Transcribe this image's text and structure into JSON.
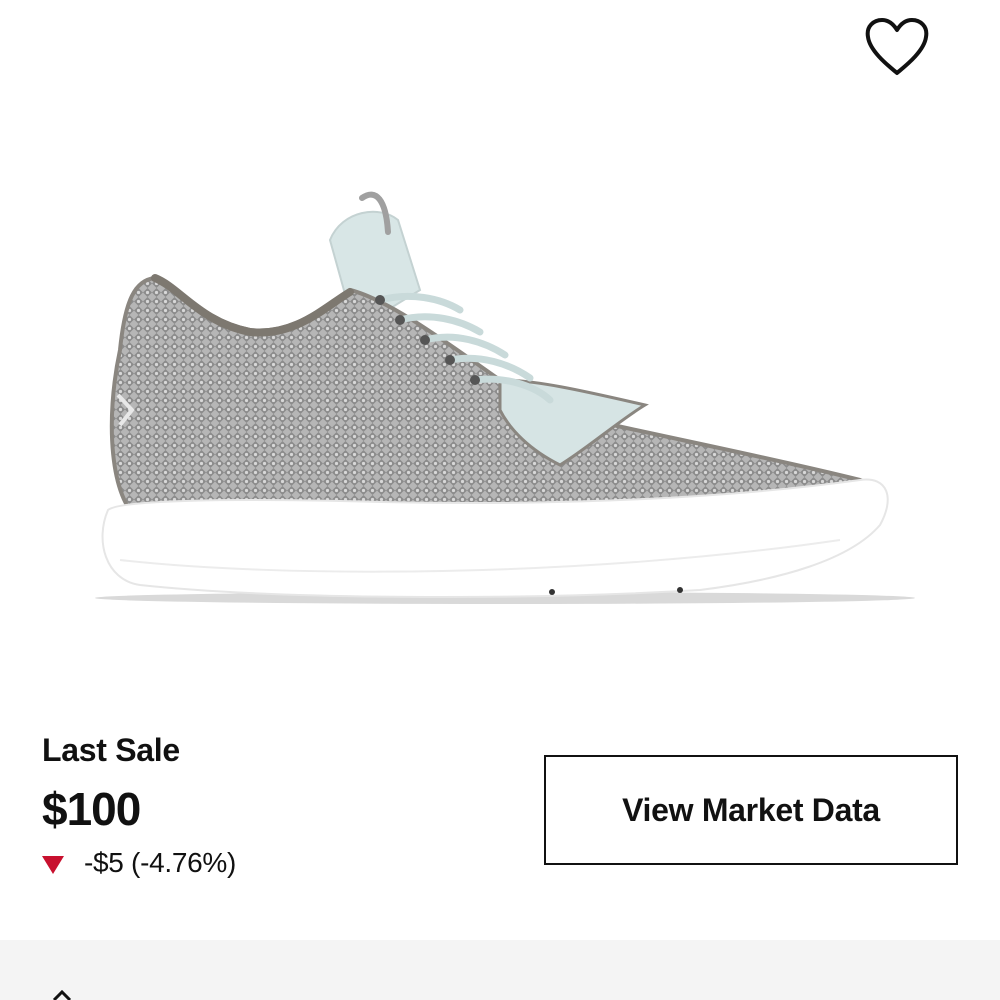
{
  "header": {
    "favorite_icon": "heart-outline-icon"
  },
  "product": {
    "image_icon": "sneaker-image",
    "colors": {
      "upper": "#9e9e9e",
      "accent": "#d6e4e4",
      "sole": "#ffffff"
    }
  },
  "last_sale": {
    "label": "Last Sale",
    "price": "$100",
    "change": "-$5 (-4.76%)",
    "direction_icon": "down-triangle-icon",
    "direction_color": "#c8102e"
  },
  "actions": {
    "market_data_label": "View Market Data"
  },
  "footer": {
    "background": "#f4f4f4",
    "icon": "chevron-up-icon"
  }
}
